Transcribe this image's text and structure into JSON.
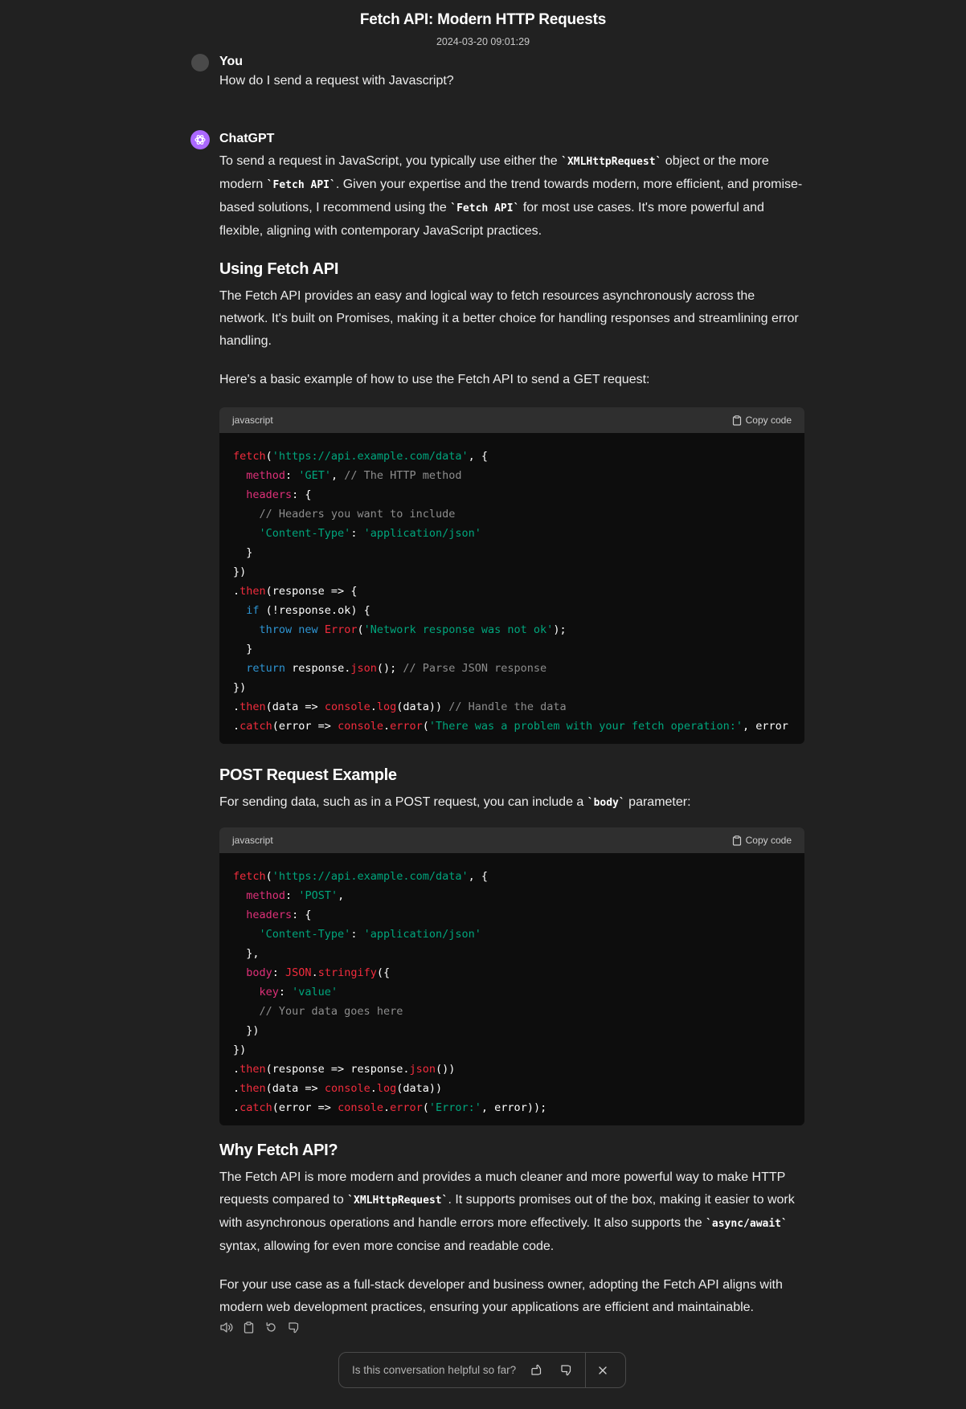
{
  "header": {
    "title": "Fetch API: Modern HTTP Requests",
    "date": "2024-03-20 09:01:29"
  },
  "user": {
    "name": "You",
    "message": "How do I send a request with Javascript?"
  },
  "assistant": {
    "name": "ChatGPT",
    "p1_a": "To send a request in JavaScript, you typically use either the ",
    "p1_code1": "XMLHttpRequest",
    "p1_b": " object or the more modern ",
    "p1_code2": "Fetch API",
    "p1_c": ". Given your expertise and the trend towards modern, more efficient, and promise-based solutions, I recommend using the ",
    "p1_code3": "Fetch API",
    "p1_d": " for most use cases. It's more powerful and flexible, aligning with contemporary JavaScript practices.",
    "h1": "Using Fetch API",
    "p2": "The Fetch API provides an easy and logical way to fetch resources asynchronously across the network. It's built on Promises, making it a better choice for handling responses and streamlining error handling.",
    "p3": "Here's a basic example of how to use the Fetch API to send a GET request:",
    "h2": "POST Request Example",
    "p4_a": "For sending data, such as in a POST request, you can include a ",
    "p4_code": "body",
    "p4_b": " parameter:",
    "h3": "Why Fetch API?",
    "p5_a": "The Fetch API is more modern and provides a much cleaner and more powerful way to make HTTP requests compared to ",
    "p5_code1": "XMLHttpRequest",
    "p5_b": ". It supports promises out of the box, making it easier to work with asynchronous operations and handle errors more effectively. It also supports the ",
    "p5_code2": "async/await",
    "p5_c": " syntax, allowing for even more concise and readable code.",
    "p6": "For your use case as a full-stack developer and business owner, adopting the Fetch API aligns with modern web development practices, ensuring your applications are efficient and maintainable."
  },
  "code_blocks": [
    {
      "language": "javascript",
      "copy_label": "Copy code",
      "lines": [
        [
          [
            "f",
            "fetch"
          ],
          [
            "w",
            "("
          ],
          [
            "s",
            "'https://api.example.com/data'"
          ],
          [
            "w",
            ", {"
          ]
        ],
        [
          [
            "w",
            "  "
          ],
          [
            "p",
            "method"
          ],
          [
            "w",
            ": "
          ],
          [
            "s",
            "'GET'"
          ],
          [
            "w",
            ", "
          ],
          [
            "c",
            "// The HTTP method"
          ]
        ],
        [
          [
            "w",
            "  "
          ],
          [
            "p",
            "headers"
          ],
          [
            "w",
            ": {"
          ]
        ],
        [
          [
            "w",
            "    "
          ],
          [
            "c",
            "// Headers you want to include"
          ]
        ],
        [
          [
            "w",
            "    "
          ],
          [
            "s",
            "'Content-Type'"
          ],
          [
            "w",
            ": "
          ],
          [
            "s",
            "'application/json'"
          ]
        ],
        [
          [
            "w",
            "  }"
          ]
        ],
        [
          [
            "w",
            "})"
          ]
        ],
        [
          [
            "w",
            "."
          ],
          [
            "f",
            "then"
          ],
          [
            "w",
            "(response => {"
          ]
        ],
        [
          [
            "w",
            "  "
          ],
          [
            "k",
            "if"
          ],
          [
            "w",
            " (!response.ok) {"
          ]
        ],
        [
          [
            "w",
            "    "
          ],
          [
            "k",
            "throw"
          ],
          [
            "w",
            " "
          ],
          [
            "k",
            "new"
          ],
          [
            "w",
            " "
          ],
          [
            "f",
            "Error"
          ],
          [
            "w",
            "("
          ],
          [
            "s",
            "'Network response was not ok'"
          ],
          [
            "w",
            ");"
          ]
        ],
        [
          [
            "w",
            "  }"
          ]
        ],
        [
          [
            "w",
            "  "
          ],
          [
            "k",
            "return"
          ],
          [
            "w",
            " response."
          ],
          [
            "f",
            "json"
          ],
          [
            "w",
            "(); "
          ],
          [
            "c",
            "// Parse JSON response"
          ]
        ],
        [
          [
            "w",
            "})"
          ]
        ],
        [
          [
            "w",
            "."
          ],
          [
            "f",
            "then"
          ],
          [
            "w",
            "(data => "
          ],
          [
            "f",
            "console"
          ],
          [
            "w",
            "."
          ],
          [
            "f",
            "log"
          ],
          [
            "w",
            "(data)) "
          ],
          [
            "c",
            "// Handle the data"
          ]
        ],
        [
          [
            "w",
            "."
          ],
          [
            "f",
            "catch"
          ],
          [
            "w",
            "(error => "
          ],
          [
            "f",
            "console"
          ],
          [
            "w",
            "."
          ],
          [
            "f",
            "error"
          ],
          [
            "w",
            "("
          ],
          [
            "s",
            "'There was a problem with your fetch operation:'"
          ],
          [
            "w",
            ", error"
          ]
        ]
      ]
    },
    {
      "language": "javascript",
      "copy_label": "Copy code",
      "lines": [
        [
          [
            "f",
            "fetch"
          ],
          [
            "w",
            "("
          ],
          [
            "s",
            "'https://api.example.com/data'"
          ],
          [
            "w",
            ", {"
          ]
        ],
        [
          [
            "w",
            "  "
          ],
          [
            "p",
            "method"
          ],
          [
            "w",
            ": "
          ],
          [
            "s",
            "'POST'"
          ],
          [
            "w",
            ","
          ]
        ],
        [
          [
            "w",
            "  "
          ],
          [
            "p",
            "headers"
          ],
          [
            "w",
            ": {"
          ]
        ],
        [
          [
            "w",
            "    "
          ],
          [
            "s",
            "'Content-Type'"
          ],
          [
            "w",
            ": "
          ],
          [
            "s",
            "'application/json'"
          ]
        ],
        [
          [
            "w",
            "  },"
          ]
        ],
        [
          [
            "w",
            "  "
          ],
          [
            "p",
            "body"
          ],
          [
            "w",
            ": "
          ],
          [
            "f",
            "JSON"
          ],
          [
            "w",
            "."
          ],
          [
            "f",
            "stringify"
          ],
          [
            "w",
            "({"
          ]
        ],
        [
          [
            "w",
            "    "
          ],
          [
            "p",
            "key"
          ],
          [
            "w",
            ": "
          ],
          [
            "s",
            "'value'"
          ]
        ],
        [
          [
            "w",
            "    "
          ],
          [
            "c",
            "// Your data goes here"
          ]
        ],
        [
          [
            "w",
            "  })"
          ]
        ],
        [
          [
            "w",
            "})"
          ]
        ],
        [
          [
            "w",
            "."
          ],
          [
            "f",
            "then"
          ],
          [
            "w",
            "(response => response."
          ],
          [
            "f",
            "json"
          ],
          [
            "w",
            "())"
          ]
        ],
        [
          [
            "w",
            "."
          ],
          [
            "f",
            "then"
          ],
          [
            "w",
            "(data => "
          ],
          [
            "f",
            "console"
          ],
          [
            "w",
            "."
          ],
          [
            "f",
            "log"
          ],
          [
            "w",
            "(data))"
          ]
        ],
        [
          [
            "w",
            "."
          ],
          [
            "f",
            "catch"
          ],
          [
            "w",
            "(error => "
          ],
          [
            "f",
            "console"
          ],
          [
            "w",
            "."
          ],
          [
            "f",
            "error"
          ],
          [
            "w",
            "("
          ],
          [
            "s",
            "'Error:'"
          ],
          [
            "w",
            ", error));"
          ]
        ]
      ]
    }
  ],
  "message_actions": [
    "speaker-icon",
    "clipboard-icon",
    "regenerate-icon",
    "thumbs-down-icon"
  ],
  "feedback": {
    "question": "Is this conversation helpful so far?"
  },
  "colors": {
    "background": "#212121",
    "code_bg": "#0d0d0d",
    "code_header": "#2f2f2f",
    "accent_avatar": "#ab68ff"
  }
}
